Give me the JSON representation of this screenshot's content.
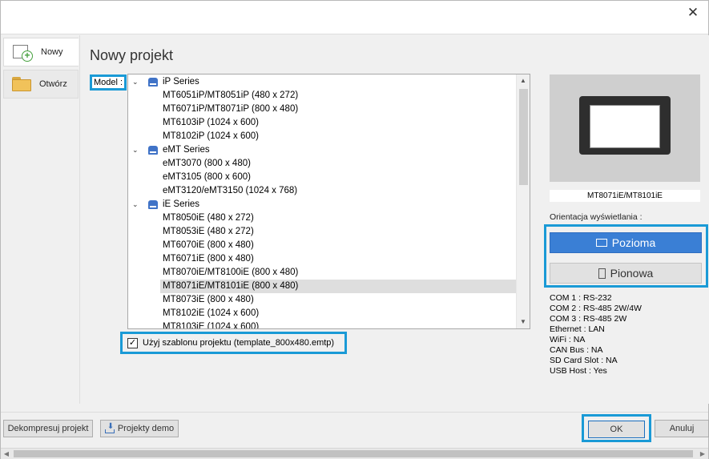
{
  "window": {
    "close_glyph": "✕"
  },
  "nav": {
    "new_label": "Nowy",
    "open_label": "Otwórz"
  },
  "main": {
    "title": "Nowy projekt",
    "model_label": "Model :"
  },
  "tree": {
    "series": [
      {
        "label": "iP Series",
        "items": [
          "MT6051iP/MT8051iP (480 x 272)",
          "MT6071iP/MT8071iP (800 x 480)",
          "MT6103iP (1024 x 600)",
          "MT8102iP (1024 x 600)"
        ]
      },
      {
        "label": "eMT Series",
        "items": [
          "eMT3070 (800 x 480)",
          "eMT3105 (800 x 600)",
          "eMT3120/eMT3150 (1024 x 768)"
        ]
      },
      {
        "label": "iE Series",
        "items": [
          "MT8050iE (480 x 272)",
          "MT8053iE (480 x 272)",
          "MT6070iE (800 x 480)",
          "MT6071iE (800 x 480)",
          "MT8070iE/MT8100iE (800 x 480)",
          "MT8071iE/MT8101iE (800 x 480)",
          "MT8073iE (800 x 480)",
          "MT8102iE (1024 x 600)",
          "MT8103iE (1024 x 600)"
        ]
      }
    ],
    "selected": "MT8071iE/MT8101iE (800 x 480)"
  },
  "template": {
    "checked": true,
    "label": "Użyj szablonu projektu (template_800x480.emtp)"
  },
  "preview": {
    "model_name": "MT8071iE/MT8101iE",
    "orientation_label": "Orientacja wyświetlania :",
    "landscape_label": "Pozioma",
    "portrait_label": "Pionowa",
    "accent_color": "#3a7fd5"
  },
  "specs": [
    "COM 1 : RS-232",
    "COM 2 : RS-485 2W/4W",
    "COM 3 : RS-485 2W",
    "Ethernet : LAN",
    "WiFi : NA",
    "CAN Bus : NA",
    "SD Card Slot : NA",
    "USB Host : Yes"
  ],
  "buttons": {
    "decompress": "Dekompresuj projekt",
    "demo": "Projekty demo",
    "ok": "OK",
    "cancel": "Anuluj"
  },
  "highlight_color": "#1a9ad6"
}
